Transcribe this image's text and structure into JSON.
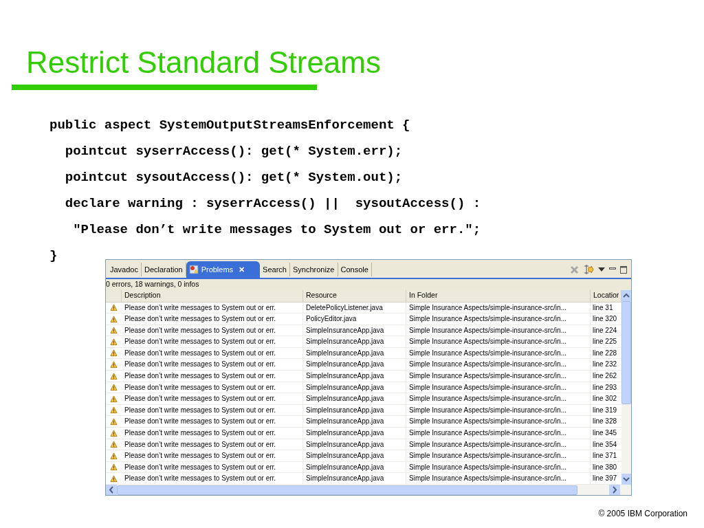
{
  "slide": {
    "title": "Restrict Standard Streams",
    "footer": "© 2005 IBM Corporation"
  },
  "code": [
    "public aspect SystemOutputStreamsEnforcement {",
    "  pointcut syserrAccess(): get(* System.err);",
    "  pointcut sysoutAccess(): get(* System.out);",
    "  declare warning : syserrAccess() ||  sysoutAccess() :",
    "   \"Please don’t write messages to System out or err.\";",
    "}"
  ],
  "panel": {
    "tabs": [
      {
        "label": "Javadoc",
        "selected": false
      },
      {
        "label": "Declaration",
        "selected": false
      },
      {
        "label": "Problems",
        "selected": true,
        "close": "✕"
      },
      {
        "label": "Search",
        "selected": false
      },
      {
        "label": "Synchronize",
        "selected": false
      },
      {
        "label": "Console",
        "selected": false
      }
    ],
    "summary": "0 errors, 18 warnings, 0 infos",
    "table": {
      "columns": [
        "Description",
        "Resource",
        "In Folder",
        "Locatior"
      ],
      "rows": [
        {
          "description": "Please don’t write messages to System out or err.",
          "resource": "DeletePolicyListener.java",
          "folder": "Simple Insurance Aspects/simple-insurance-src/in...",
          "location": "line 31"
        },
        {
          "description": "Please don’t write messages to System out or err.",
          "resource": "PolicyEditor.java",
          "folder": "Simple Insurance Aspects/simple-insurance-src/in...",
          "location": "line 320"
        },
        {
          "description": "Please don’t write messages to System out or err.",
          "resource": "SimpleInsuranceApp.java",
          "folder": "Simple Insurance Aspects/simple-insurance-src/in...",
          "location": "line 224"
        },
        {
          "description": "Please don’t write messages to System out or err.",
          "resource": "SimpleInsuranceApp.java",
          "folder": "Simple Insurance Aspects/simple-insurance-src/in...",
          "location": "line 225"
        },
        {
          "description": "Please don’t write messages to System out or err.",
          "resource": "SimpleInsuranceApp.java",
          "folder": "Simple Insurance Aspects/simple-insurance-src/in...",
          "location": "line 228"
        },
        {
          "description": "Please don’t write messages to System out or err.",
          "resource": "SimpleInsuranceApp.java",
          "folder": "Simple Insurance Aspects/simple-insurance-src/in...",
          "location": "line 232"
        },
        {
          "description": "Please don’t write messages to System out or err.",
          "resource": "SimpleInsuranceApp.java",
          "folder": "Simple Insurance Aspects/simple-insurance-src/in...",
          "location": "line 262"
        },
        {
          "description": "Please don’t write messages to System out or err.",
          "resource": "SimpleInsuranceApp.java",
          "folder": "Simple Insurance Aspects/simple-insurance-src/in...",
          "location": "line 293"
        },
        {
          "description": "Please don’t write messages to System out or err.",
          "resource": "SimpleInsuranceApp.java",
          "folder": "Simple Insurance Aspects/simple-insurance-src/in...",
          "location": "line 302"
        },
        {
          "description": "Please don’t write messages to System out or err.",
          "resource": "SimpleInsuranceApp.java",
          "folder": "Simple Insurance Aspects/simple-insurance-src/in...",
          "location": "line 319"
        },
        {
          "description": "Please don’t write messages to System out or err.",
          "resource": "SimpleInsuranceApp.java",
          "folder": "Simple Insurance Aspects/simple-insurance-src/in...",
          "location": "line 328"
        },
        {
          "description": "Please don’t write messages to System out or err.",
          "resource": "SimpleInsuranceApp.java",
          "folder": "Simple Insurance Aspects/simple-insurance-src/in...",
          "location": "line 345"
        },
        {
          "description": "Please don’t write messages to System out or err.",
          "resource": "SimpleInsuranceApp.java",
          "folder": "Simple Insurance Aspects/simple-insurance-src/in...",
          "location": "line 354"
        },
        {
          "description": "Please don’t write messages to System out or err.",
          "resource": "SimpleInsuranceApp.java",
          "folder": "Simple Insurance Aspects/simple-insurance-src/in...",
          "location": "line 371"
        },
        {
          "description": "Please don’t write messages to System out or err.",
          "resource": "SimpleInsuranceApp.java",
          "folder": "Simple Insurance Aspects/simple-insurance-src/in...",
          "location": "line 380"
        },
        {
          "description": "Please don’t write messages to System out or err.",
          "resource": "SimpleInsuranceApp.java",
          "folder": "Simple Insurance Aspects/simple-insurance-src/in...",
          "location": "line 397"
        }
      ]
    }
  }
}
